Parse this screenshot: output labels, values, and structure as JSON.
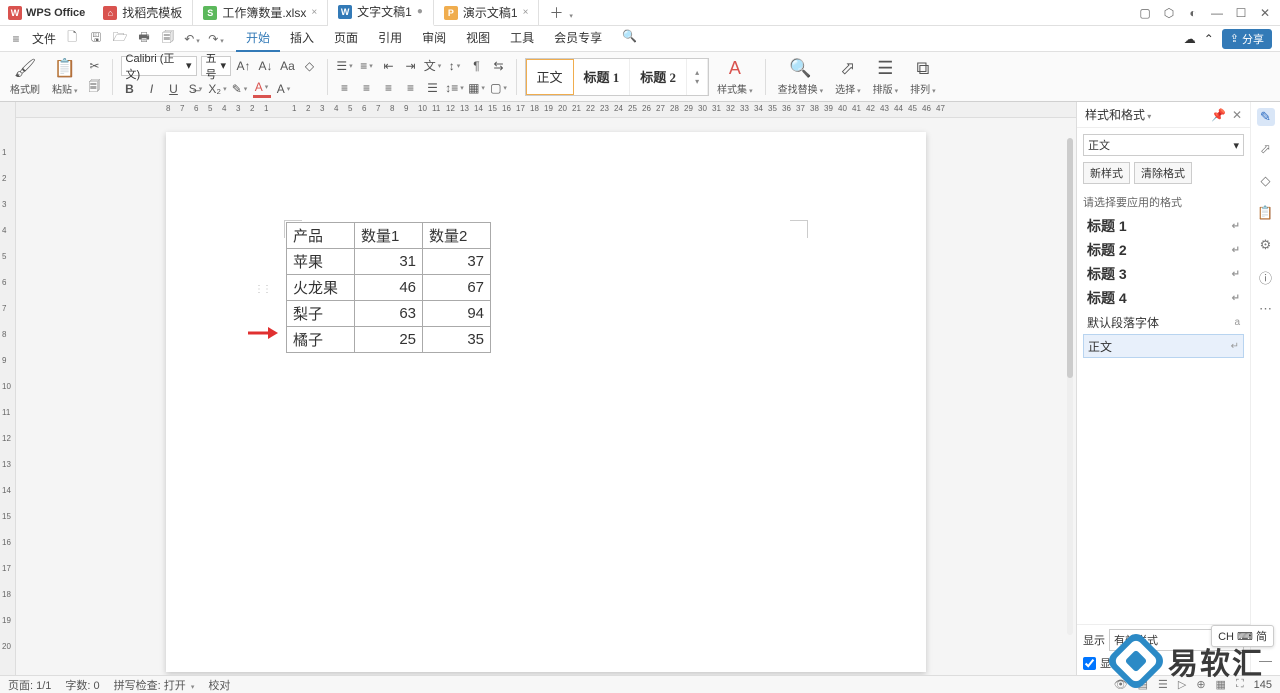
{
  "app": {
    "name": "WPS Office"
  },
  "tabs": [
    {
      "icon": "red",
      "glyph": "⌂",
      "label": "找稻壳模板",
      "active": false
    },
    {
      "icon": "green",
      "glyph": "S",
      "label": "工作簿数量.xlsx",
      "active": false
    },
    {
      "icon": "blue",
      "glyph": "W",
      "label": "文字文稿1",
      "active": true
    },
    {
      "icon": "orange",
      "glyph": "P",
      "label": "演示文稿1",
      "active": false
    }
  ],
  "menubar": {
    "file": "文件",
    "items": [
      "开始",
      "插入",
      "页面",
      "引用",
      "审阅",
      "视图",
      "工具",
      "会员专享"
    ],
    "active": "开始",
    "share": "分享"
  },
  "toolbar": {
    "format_painter": "格式刷",
    "paste": "粘贴",
    "font_name": "Calibri (正文)",
    "font_size": "五号",
    "styles": {
      "normal": "正文",
      "h1": "标题 1",
      "h2": "标题 2"
    },
    "style_set": "样式集",
    "find_replace": "查找替换",
    "select": "选择",
    "layout": "排版",
    "arrange": "排列"
  },
  "ruler_top": [
    "8",
    "7",
    "6",
    "5",
    "4",
    "3",
    "2",
    "1",
    "",
    "1",
    "2",
    "3",
    "4",
    "5",
    "6",
    "7",
    "8",
    "9",
    "10",
    "11",
    "12",
    "13",
    "14",
    "15",
    "16",
    "17",
    "18",
    "19",
    "20",
    "21",
    "22",
    "23",
    "24",
    "25",
    "26",
    "27",
    "28",
    "29",
    "30",
    "31",
    "32",
    "33",
    "34",
    "35",
    "36",
    "37",
    "38",
    "39",
    "40",
    "41",
    "42",
    "43",
    "44",
    "45",
    "46",
    "47"
  ],
  "document": {
    "table": {
      "headers": [
        "产品",
        "数量1",
        "数量2"
      ],
      "rows": [
        [
          "苹果",
          "31",
          "37"
        ],
        [
          "火龙果",
          "46",
          "67"
        ],
        [
          "梨子",
          "63",
          "94"
        ],
        [
          "橘子",
          "25",
          "35"
        ]
      ]
    }
  },
  "styles_panel": {
    "title": "样式和格式",
    "current": "正文",
    "new_style": "新样式",
    "clear": "清除格式",
    "hint": "请选择要应用的格式",
    "list": [
      {
        "label": "标题 1",
        "heading": true
      },
      {
        "label": "标题 2",
        "heading": true
      },
      {
        "label": "标题 3",
        "heading": true
      },
      {
        "label": "标题 4",
        "heading": true
      },
      {
        "label": "默认段落字体",
        "heading": false,
        "icon": "a"
      },
      {
        "label": "正文",
        "heading": false,
        "selected": true
      }
    ],
    "show_label": "显示",
    "show_value": "有效样式",
    "preview_cb": "显示"
  },
  "statusbar": {
    "page": "页面: 1/1",
    "words": "字数: 0",
    "spell": "拼写检查: 打开",
    "proof": "校对",
    "zoom": "145"
  },
  "ime": "CH ⌨ 简",
  "watermark": "易软汇"
}
